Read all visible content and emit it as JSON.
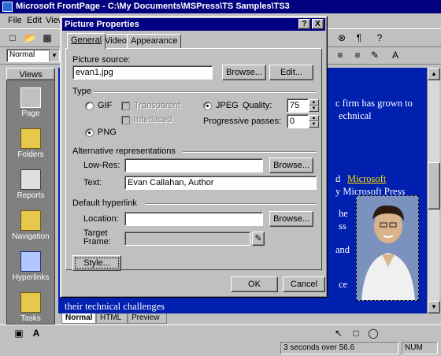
{
  "app": {
    "title": "Microsoft FrontPage - C:\\My Documents\\MSPress\\TS Samples\\TS3",
    "menus": [
      "File",
      "Edit",
      "View"
    ]
  },
  "toolbar": {
    "style_value": "Normal",
    "icons": [
      "new-icon",
      "open-icon",
      "save-icon"
    ]
  },
  "views": {
    "header": "Views",
    "items": [
      {
        "label": "Page",
        "icon": "page-icon"
      },
      {
        "label": "Folders",
        "icon": "folder-icon"
      },
      {
        "label": "Reports",
        "icon": "reports-icon"
      },
      {
        "label": "Navigation",
        "icon": "navigation-icon"
      },
      {
        "label": "Hyperlinks",
        "icon": "hyperlinks-icon"
      },
      {
        "label": "Tasks",
        "icon": "tasks-icon"
      }
    ]
  },
  "editor": {
    "lines": [
      "c firm has grown to",
      "echnical",
      "d",
      "y Microsoft Press",
      "he",
      "ss",
      "and",
      "ce",
      "their technical challenges"
    ],
    "link_text": "Microsoft"
  },
  "view_tabs": [
    "Normal",
    "HTML",
    "Preview"
  ],
  "status": {
    "download_time": "3 seconds over 56.6",
    "num": "NUM"
  },
  "dialog": {
    "title": "Picture Properties",
    "tabs": [
      "General",
      "Video",
      "Appearance"
    ],
    "picture_source_label": "Picture source:",
    "picture_source_value": "evan1.jpg",
    "browse_label": "Browse...",
    "edit_label": "Edit...",
    "type_label": "Type",
    "gif_label": "GIF",
    "png_label": "PNG",
    "jpeg_label": "JPEG",
    "transparent_label": "Transparent",
    "interlaced_label": "Interlaced",
    "quality_label": "Quality:",
    "quality_value": "75",
    "progressive_label": "Progressive passes:",
    "progressive_value": "0",
    "alt_group_label": "Alternative representations",
    "lowres_label": "Low-Res:",
    "lowres_value": "",
    "text_label": "Text:",
    "text_value": "Evan Callahan, Author",
    "hyperlink_group_label": "Default hyperlink",
    "location_label": "Location:",
    "location_value": "",
    "target_label_1": "Target",
    "target_label_2": "Frame:",
    "target_value": "",
    "style_button": "Style...",
    "ok_button": "OK",
    "cancel_button": "Cancel",
    "help_btn": "?",
    "close_btn": "X"
  }
}
